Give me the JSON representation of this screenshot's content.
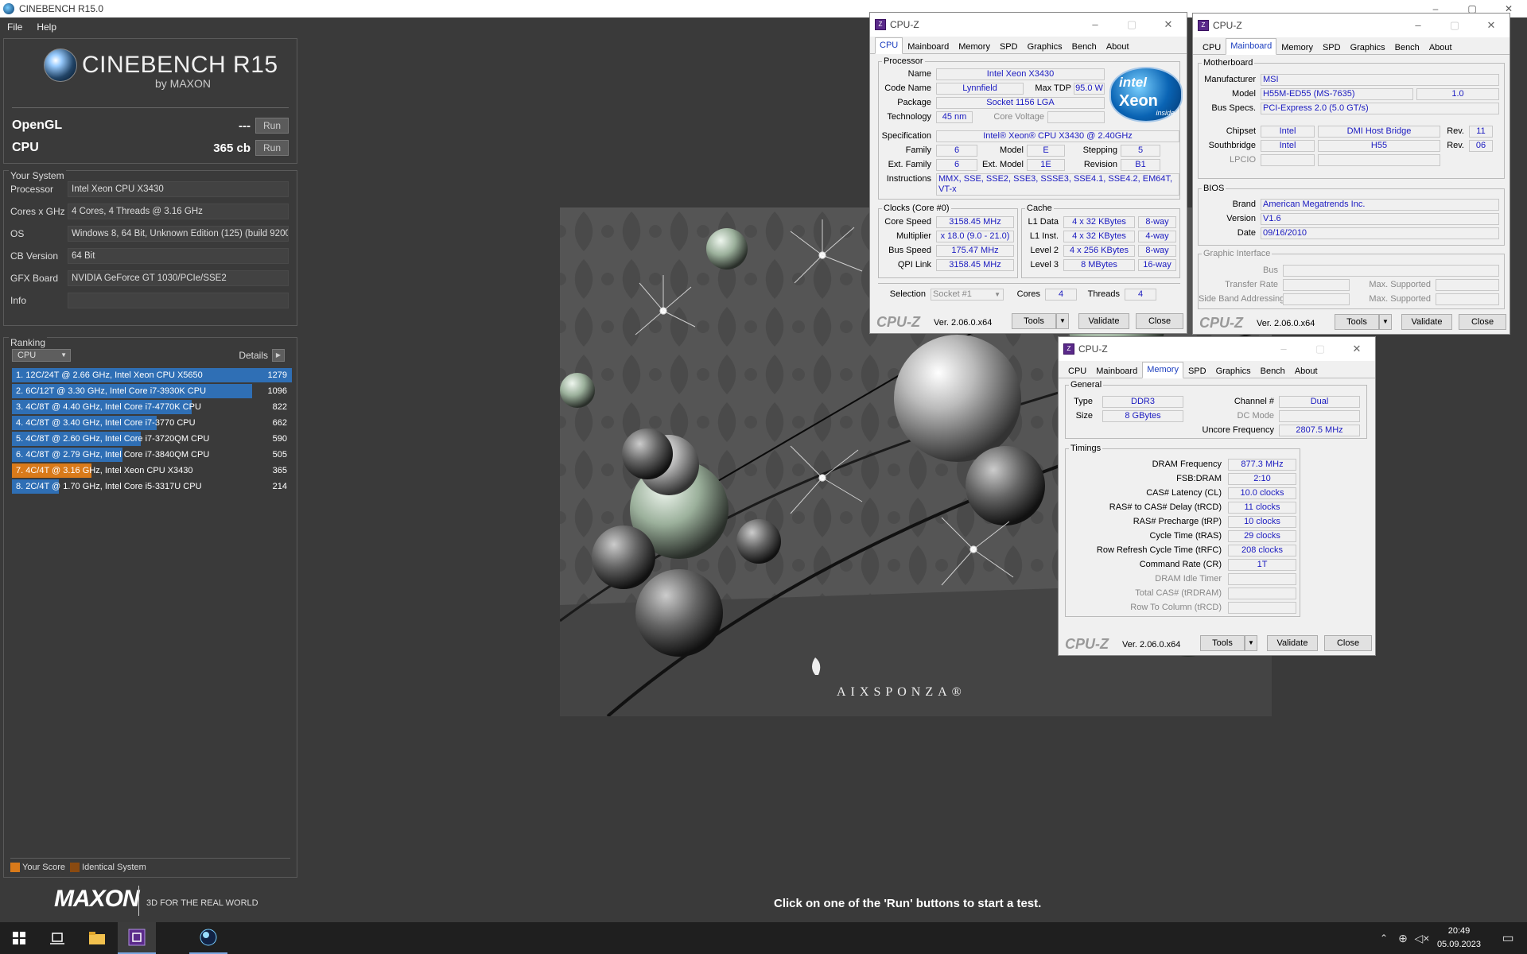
{
  "window": {
    "title": "CINEBENCH R15.0",
    "min": "–",
    "max": "▢",
    "close": "✕"
  },
  "menu": [
    "File",
    "Help"
  ],
  "logo": {
    "title": "CINEBENCH R15",
    "by": "by MAXON"
  },
  "tests": {
    "opengl": {
      "label": "OpenGL",
      "value": "---",
      "run": "Run"
    },
    "cpu": {
      "label": "CPU",
      "value": "365 cb",
      "run": "Run"
    }
  },
  "system": {
    "title": "Your System",
    "rows": [
      {
        "k": "Processor",
        "v": "Intel Xeon CPU X3430"
      },
      {
        "k": "Cores x GHz",
        "v": "4 Cores, 4 Threads @ 3.16 GHz"
      },
      {
        "k": "OS",
        "v": "Windows 8, 64 Bit, Unknown Edition (125) (build 9200"
      },
      {
        "k": "CB Version",
        "v": "64 Bit"
      },
      {
        "k": "GFX Board",
        "v": "NVIDIA GeForce GT 1030/PCIe/SSE2"
      },
      {
        "k": "Info",
        "v": ""
      }
    ]
  },
  "ranking": {
    "title": "Ranking",
    "select": "CPU",
    "details": "Details",
    "max_score": 1279,
    "items": [
      {
        "text": "1. 12C/24T @ 2.66 GHz, Intel Xeon CPU X5650",
        "score": 1279,
        "mine": false
      },
      {
        "text": "2. 6C/12T @ 3.30 GHz,  Intel Core i7-3930K CPU",
        "score": 1096,
        "mine": false
      },
      {
        "text": "3. 4C/8T @ 4.40 GHz, Intel Core i7-4770K CPU",
        "score": 822,
        "mine": false
      },
      {
        "text": "4. 4C/8T @ 3.40 GHz,  Intel Core i7-3770 CPU",
        "score": 662,
        "mine": false
      },
      {
        "text": "5. 4C/8T @ 2.60 GHz, Intel Core i7-3720QM CPU",
        "score": 590,
        "mine": false
      },
      {
        "text": "6. 4C/8T @ 2.79 GHz,  Intel Core i7-3840QM CPU",
        "score": 505,
        "mine": false
      },
      {
        "text": "7. 4C/4T @ 3.16 GHz, Intel Xeon CPU X3430",
        "score": 365,
        "mine": true
      },
      {
        "text": "8. 2C/4T @ 1.70 GHz,  Intel Core i5-3317U CPU",
        "score": 214,
        "mine": false
      }
    ],
    "legend": {
      "your_score": "Your Score",
      "identical": "Identical System"
    }
  },
  "colors": {
    "bar": "#2f6fb5",
    "mine": "#d97a1a",
    "identical": "#8a4a10"
  },
  "footer": {
    "brand": "MAXON",
    "tagline": "3D FOR THE REAL WORLD",
    "status": "Click on one of the 'Run' buttons to start a test."
  },
  "render": {
    "watermark": "AIXSPONZA®"
  },
  "cpuz_common": {
    "title": "CPU-Z",
    "tabs": [
      "CPU",
      "Mainboard",
      "Memory",
      "SPD",
      "Graphics",
      "Bench",
      "About"
    ],
    "brand": "CPU-Z",
    "version": "Ver. 2.06.0.x64",
    "tools": "Tools",
    "validate": "Validate",
    "close": "Close"
  },
  "cpuz_cpu": {
    "processor_title": "Processor",
    "name_l": "Name",
    "name": "Intel Xeon X3430",
    "code_l": "Code Name",
    "code": "Lynnfield",
    "tdp_l": "Max TDP",
    "tdp": "95.0 W",
    "pkg_l": "Package",
    "pkg": "Socket 1156 LGA",
    "tech_l": "Technology",
    "tech": "45 nm",
    "cv_l": "Core Voltage",
    "cv": "",
    "spec_l": "Specification",
    "spec": "Intel® Xeon® CPU         X3430  @ 2.40GHz",
    "fam_l": "Family",
    "fam": "6",
    "model_l": "Model",
    "model": "E",
    "step_l": "Stepping",
    "step": "5",
    "efam_l": "Ext. Family",
    "efam": "6",
    "emodel_l": "Ext. Model",
    "emodel": "1E",
    "rev_l": "Revision",
    "rev": "B1",
    "instr_l": "Instructions",
    "instr": "MMX, SSE, SSE2, SSE3, SSSE3, SSE4.1, SSE4.2, EM64T, VT-x",
    "clocks_title": "Clocks (Core #0)",
    "cs_l": "Core Speed",
    "cs": "3158.45 MHz",
    "mul_l": "Multiplier",
    "mul": "x 18.0 (9.0 - 21.0)",
    "bus_l": "Bus Speed",
    "bus": "175.47 MHz",
    "qpi_l": "QPI Link",
    "qpi": "3158.45 MHz",
    "cache_title": "Cache",
    "l1d_l": "L1 Data",
    "l1d": "4 x 32 KBytes",
    "l1d_w": "8-way",
    "l1i_l": "L1 Inst.",
    "l1i": "4 x 32 KBytes",
    "l1i_w": "4-way",
    "l2_l": "Level 2",
    "l2": "4 x 256 KBytes",
    "l2_w": "8-way",
    "l3_l": "Level 3",
    "l3": "8 MBytes",
    "l3_w": "16-way",
    "sel_l": "Selection",
    "sel": "Socket #1",
    "cores_l": "Cores",
    "cores": "4",
    "threads_l": "Threads",
    "threads": "4",
    "intel": {
      "brand": "intel",
      "product": "Xeon",
      "inside": "inside"
    }
  },
  "cpuz_mb": {
    "mb_title": "Motherboard",
    "man_l": "Manufacturer",
    "man": "MSI",
    "model_l": "Model",
    "model": "H55M-ED55 (MS-7635)",
    "model_rev": "1.0",
    "bus_l": "Bus Specs.",
    "bus": "PCI-Express 2.0 (5.0 GT/s)",
    "chip_l": "Chipset",
    "chip": "Intel",
    "chip2": "DMI Host Bridge",
    "chip_rev_l": "Rev.",
    "chip_rev": "11",
    "sb_l": "Southbridge",
    "sb": "Intel",
    "sb2": "H55",
    "sb_rev_l": "Rev.",
    "sb_rev": "06",
    "lpcio_l": "LPCIO",
    "bios_title": "BIOS",
    "brand_l": "Brand",
    "brand": "American Megatrends Inc.",
    "ver_l": "Version",
    "ver": "V1.6",
    "date_l": "Date",
    "date": "09/16/2010",
    "gi_title": "Graphic Interface",
    "gbus_l": "Bus",
    "tr_l": "Transfer Rate",
    "ms1_l": "Max. Supported",
    "sba_l": "Side Band Addressing",
    "ms2_l": "Max. Supported"
  },
  "cpuz_mem": {
    "gen_title": "General",
    "type_l": "Type",
    "type": "DDR3",
    "size_l": "Size",
    "size": "8 GBytes",
    "ch_l": "Channel #",
    "ch": "Dual",
    "dc_l": "DC Mode",
    "dc": "",
    "unc_l": "Uncore Frequency",
    "unc": "2807.5 MHz",
    "tim_title": "Timings",
    "timings": [
      {
        "l": "DRAM Frequency",
        "v": "877.3 MHz",
        "dim": false
      },
      {
        "l": "FSB:DRAM",
        "v": "2:10",
        "dim": false
      },
      {
        "l": "CAS# Latency (CL)",
        "v": "10.0 clocks",
        "dim": false
      },
      {
        "l": "RAS# to CAS# Delay (tRCD)",
        "v": "11 clocks",
        "dim": false
      },
      {
        "l": "RAS# Precharge (tRP)",
        "v": "10 clocks",
        "dim": false
      },
      {
        "l": "Cycle Time (tRAS)",
        "v": "29 clocks",
        "dim": false
      },
      {
        "l": "Row Refresh Cycle Time (tRFC)",
        "v": "208 clocks",
        "dim": false
      },
      {
        "l": "Command Rate (CR)",
        "v": "1T",
        "dim": false
      },
      {
        "l": "DRAM Idle Timer",
        "v": "",
        "dim": true
      },
      {
        "l": "Total CAS# (tRDRAM)",
        "v": "",
        "dim": true
      },
      {
        "l": "Row To Column (tRCD)",
        "v": "",
        "dim": true
      }
    ]
  },
  "taskbar": {
    "time": "20:49",
    "date": "05.09.2023"
  }
}
